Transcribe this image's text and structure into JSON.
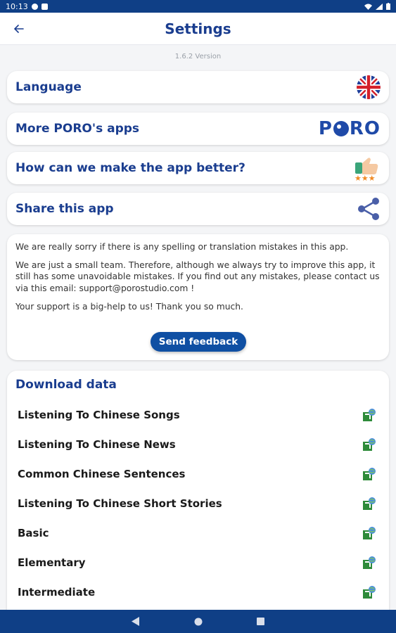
{
  "status_bar": {
    "time": "10:13"
  },
  "header": {
    "title": "Settings",
    "back_icon": "arrow-left-icon"
  },
  "version": "1.6.2 Version",
  "settings_items": [
    {
      "label": "Language",
      "icon": "uk-flag-icon"
    },
    {
      "label": "More PORO's apps",
      "icon": "poro-logo"
    },
    {
      "label": "How can we make the app better?",
      "icon": "thumbs-up-rating-icon"
    },
    {
      "label": "Share this app",
      "icon": "share-icon"
    }
  ],
  "poro_logo_text": {
    "p": "P",
    "ro": "RO"
  },
  "info": {
    "p1": "We are really sorry if there is any spelling or translation mistakes in this app.",
    "p2": "We are just a small team. Therefore, although we always try to improve this app, it still has some unavoidable mistakes. If you find out any mistakes, please contact us via this email: support@porostudio.com !",
    "p3": "Your support is a big-help to us! Thank you so much.",
    "button": "Send feedback"
  },
  "download": {
    "title": "Download data",
    "items": [
      "Listening To Chinese Songs",
      "Listening To Chinese News",
      "Common Chinese Sentences",
      "Listening To Chinese Short Stories",
      "Basic",
      "Elementary",
      "Intermediate"
    ],
    "item_icon": "download-globe-icon"
  },
  "colors": {
    "primary": "#1a3d8f",
    "bar": "#0f3f86",
    "button": "#0f4fa3"
  }
}
